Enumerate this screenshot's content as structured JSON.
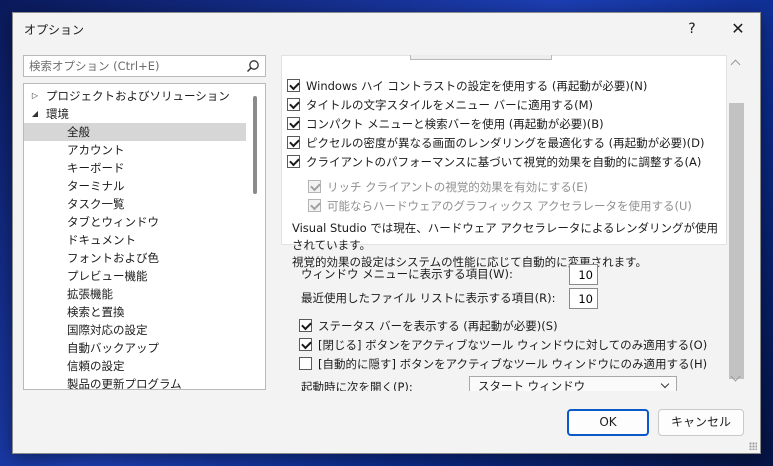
{
  "window": {
    "title": "オプション",
    "help_label": "?",
    "close_label": "✕"
  },
  "search": {
    "placeholder": "検索オプション (Ctrl+E)",
    "icon": "search-icon"
  },
  "tree": {
    "items": [
      {
        "label": "プロジェクトおよびソリューション",
        "arrow": "▷",
        "level": 0
      },
      {
        "label": "環境",
        "arrow": "◢",
        "level": 0
      },
      {
        "label": "全般",
        "level": 1,
        "selected": true
      },
      {
        "label": "アカウント",
        "level": 1
      },
      {
        "label": "キーボード",
        "level": 1
      },
      {
        "label": "ターミナル",
        "level": 1
      },
      {
        "label": "タスク一覧",
        "level": 1
      },
      {
        "label": "タブとウィンドウ",
        "level": 1
      },
      {
        "label": "ドキュメント",
        "level": 1
      },
      {
        "label": "フォントおよび色",
        "level": 1
      },
      {
        "label": "プレビュー機能",
        "level": 1
      },
      {
        "label": "拡張機能",
        "level": 1
      },
      {
        "label": "検索と置換",
        "level": 1
      },
      {
        "label": "国際対応の設定",
        "level": 1
      },
      {
        "label": "自動バックアップ",
        "level": 1
      },
      {
        "label": "信頼の設定",
        "level": 1
      },
      {
        "label": "製品の更新プログラム",
        "level": 1
      }
    ]
  },
  "visual": {
    "options": [
      {
        "label": "Windows ハイ コントラストの設定を使用する (再起動が必要)(N)",
        "checked": true,
        "enabled": true
      },
      {
        "label": "タイトルの文字スタイルをメニュー バーに適用する(M)",
        "checked": true,
        "enabled": true
      },
      {
        "label": "コンパクト メニューと検索バーを使用 (再起動が必要)(B)",
        "checked": true,
        "enabled": true
      },
      {
        "label": "ピクセルの密度が異なる画面のレンダリングを最適化する (再起動が必要)(D)",
        "checked": true,
        "enabled": true
      },
      {
        "label": "クライアントのパフォーマンスに基づいて視覚的効果を自動的に調整する(A)",
        "checked": true,
        "enabled": true
      },
      {
        "label": "リッチ クライアントの視覚的効果を有効にする(E)",
        "checked": true,
        "enabled": false
      },
      {
        "label": "可能ならハードウェアのグラフィックス アクセラレータを使用する(U)",
        "checked": true,
        "enabled": false
      }
    ],
    "note_line1": "Visual Studio では現在、ハードウェア アクセラレータによるレンダリングが使用されています。",
    "note_line2": "視覚的効果の設定はシステムの性能に応じて自動的に変更されます。"
  },
  "fields": {
    "window_menu_label": "ウィンドウ メニューに表示する項目(W):",
    "window_menu_value": "10",
    "recent_files_label": "最近使用したファイル リストに表示する項目(R):",
    "recent_files_value": "10"
  },
  "options2": [
    {
      "label": "ステータス バーを表示する (再起動が必要)(S)",
      "checked": true
    },
    {
      "label": "[閉じる] ボタンをアクティブなツール ウィンドウに対してのみ適用する(O)",
      "checked": true
    },
    {
      "label": "[自動的に隠す] ボタンをアクティブなツール ウィンドウにのみ適用する(H)",
      "checked": false
    }
  ],
  "startup": {
    "label": "起動時に次を開く(P):",
    "value": "スタート ウィンドウ"
  },
  "buttons": {
    "ok": "OK",
    "cancel": "キャンセル"
  },
  "colors": {
    "accent": "#0a59c9",
    "selected_bg": "#d6d6d6",
    "dialog_bg": "#f3f3f3"
  }
}
